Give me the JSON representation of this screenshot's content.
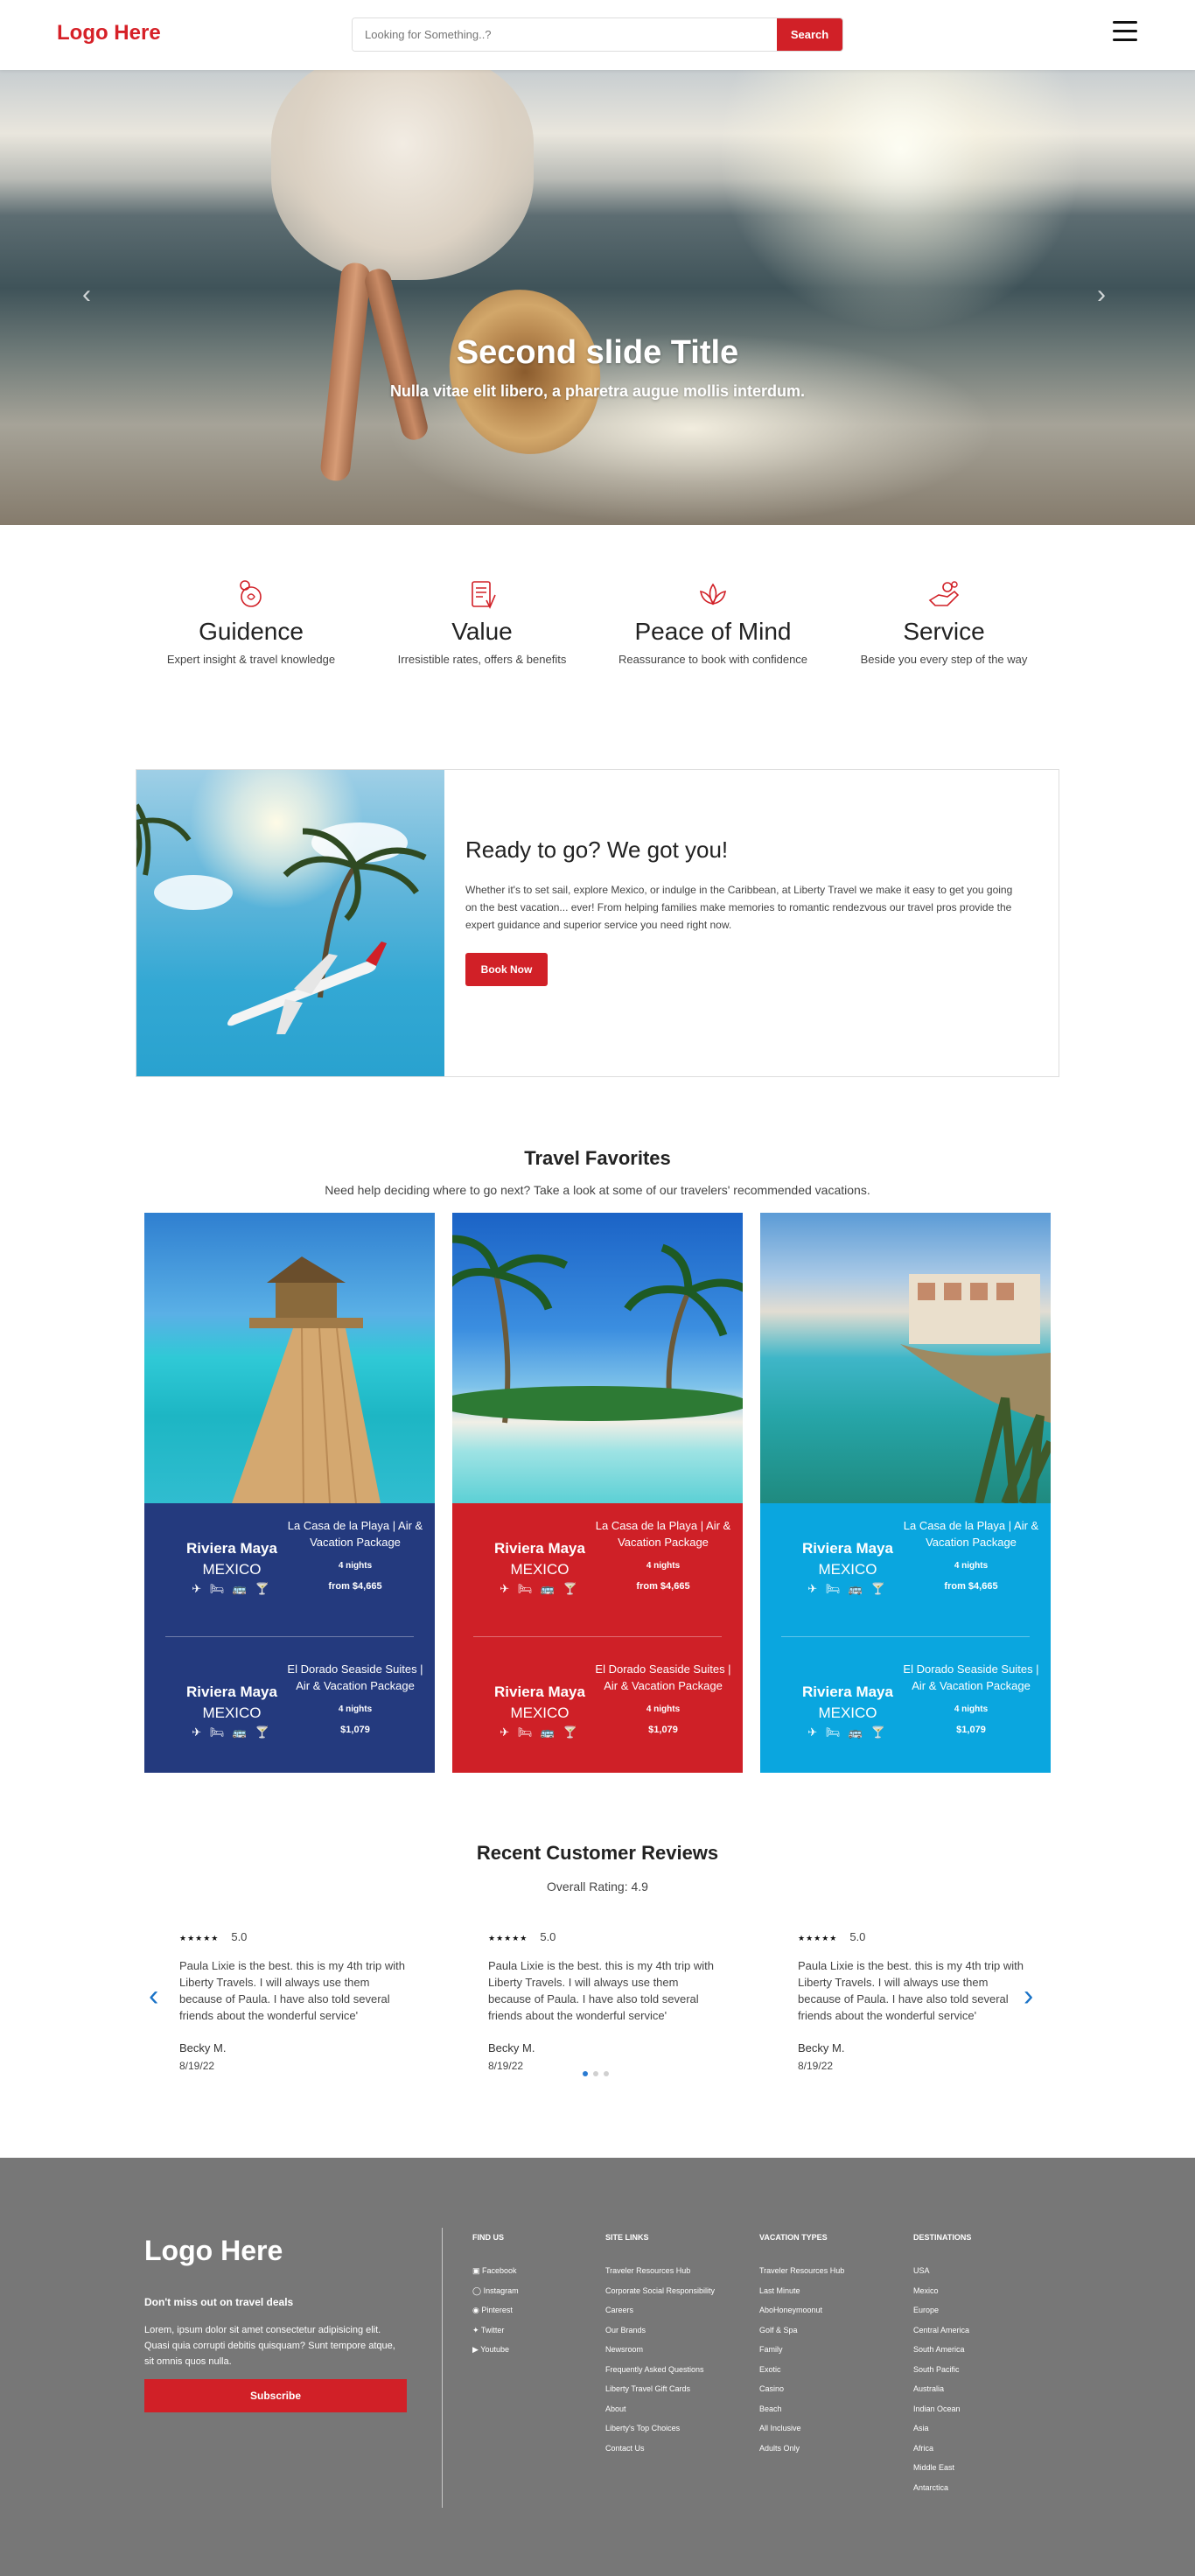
{
  "header": {
    "logo": "Logo Here",
    "search_placeholder": "Looking for Something..?",
    "search_button": "Search"
  },
  "hero": {
    "title": "Second slide Title",
    "subtitle": "Nulla vitae elit libero, a pharetra augue mollis interdum."
  },
  "features": [
    {
      "title": "Guidence",
      "desc": "Expert insight & travel knowledge",
      "icon": "guidance-icon"
    },
    {
      "title": "Value",
      "desc": "Irresistible rates, offers & benefits",
      "icon": "document-icon"
    },
    {
      "title": "Peace of Mind",
      "desc": "Reassurance to book with confidence",
      "icon": "lotus-icon"
    },
    {
      "title": "Service",
      "desc": "Beside you every step of the way",
      "icon": "service-icon"
    }
  ],
  "ready": {
    "title": "Ready to go? We got you!",
    "body": "Whether it's to set sail, explore Mexico, or indulge in the Caribbean, at Liberty Travel we make it easy to get you going on the best vacation... ever! From helping families make memories to romantic rendezvous our travel pros provide the expert guidance and superior service you need right now.",
    "button": "Book Now"
  },
  "favorites": {
    "title": "Travel Favorites",
    "subtitle": "Need help deciding where to go next? Take a look at some of our travelers' recommended vacations.",
    "cards": [
      {
        "color": "#243a7e",
        "offers": [
          {
            "destination": "Riviera Maya",
            "country": "MEXICO",
            "amenities": "✈ 🛏 🚌 🍸",
            "package": "La Casa de la Playa | Air & Vacation Package",
            "nights": "4 nights",
            "price": "from $4,665"
          },
          {
            "destination": "Riviera Maya",
            "country": "MEXICO",
            "amenities": "✈ 🛏 🚌 🍸",
            "package": "El Dorado Seaside Suites | Air & Vacation Package",
            "nights": "4 nights",
            "price": "$1,079"
          }
        ]
      },
      {
        "color": "#cf2027",
        "offers": [
          {
            "destination": "Riviera Maya",
            "country": "MEXICO",
            "amenities": "✈ 🛏 🚌 🍸",
            "package": "La Casa de la Playa | Air & Vacation Package",
            "nights": "4 nights",
            "price": "from $4,665"
          },
          {
            "destination": "Riviera Maya",
            "country": "MEXICO",
            "amenities": "✈ 🛏 🚌 🍸",
            "package": "El Dorado Seaside Suites | Air & Vacation Package",
            "nights": "4 nights",
            "price": "$1,079"
          }
        ]
      },
      {
        "color": "#0aa6df",
        "offers": [
          {
            "destination": "Riviera Maya",
            "country": "MEXICO",
            "amenities": "✈ 🛏 🚌 🍸",
            "package": "La Casa de la Playa | Air & Vacation Package",
            "nights": "4 nights",
            "price": "from $4,665"
          },
          {
            "destination": "Riviera Maya",
            "country": "MEXICO",
            "amenities": "✈ 🛏 🚌 🍸",
            "package": "El Dorado Seaside Suites | Air & Vacation Package",
            "nights": "4 nights",
            "price": "$1,079"
          }
        ]
      }
    ]
  },
  "reviews": {
    "title": "Recent Customer Reviews",
    "overall": "Overall Rating: 4.9",
    "items": [
      {
        "stars": "★★★★★",
        "score": "5.0",
        "text": "Paula Lixie is the best. this is my 4th trip with Liberty Travels. I will always use them because of Paula. I have also told several friends about the wonderful service'",
        "name": "Becky M.",
        "date": "8/19/22"
      },
      {
        "stars": "★★★★★",
        "score": "5.0",
        "text": "Paula Lixie is the best. this is my 4th trip with Liberty Travels. I will always use them because of Paula. I have also told several friends about the wonderful service'",
        "name": "Becky M.",
        "date": "8/19/22"
      },
      {
        "stars": "★★★★★",
        "score": "5.0",
        "text": "Paula Lixie is the best. this is my 4th trip with Liberty Travels. I will always use them because of Paula. I have also told several friends about the wonderful service'",
        "name": "Becky M.",
        "date": "8/19/22"
      }
    ]
  },
  "footer": {
    "logo": "Logo Here",
    "deals_title": "Don't miss out on travel deals",
    "deals_text": "Lorem, ipsum dolor sit amet consectetur adipisicing elit. Quasi quia corrupti debitis quisquam? Sunt tempore atque, sit omnis quos nulla.",
    "subscribe": "Subscribe",
    "find_us": {
      "heading": "FIND US",
      "items": [
        "Facebook",
        "Instagram",
        "Pinterest",
        "Twitter",
        "Youtube"
      ]
    },
    "site_links": {
      "heading": "SITE LINKS",
      "items": [
        "Traveler Resources Hub",
        "Corporate Social Responsibility",
        "Careers",
        "Our Brands",
        "Newsroom",
        "Frequently Asked Questions",
        "Liberty Travel Gift Cards",
        "About",
        "Liberty's Top Choices",
        "Contact Us"
      ]
    },
    "vacation_types": {
      "heading": "VACATION TYPES",
      "items": [
        "Traveler Resources Hub",
        "Last Minute",
        "AboHoneymoonut",
        "Golf & Spa",
        "Family",
        "Exotic",
        "Casino",
        "Beach",
        "All Inclusive",
        "Adults Only"
      ]
    },
    "destinations": {
      "heading": "DESTINATIONS",
      "items": [
        "USA",
        "Mexico",
        "Europe",
        "Central America",
        "South America",
        "South Pacific",
        "Australia",
        "Indian Ocean",
        "Asia",
        "Africa",
        "Middle East",
        "Antarctica"
      ]
    }
  }
}
